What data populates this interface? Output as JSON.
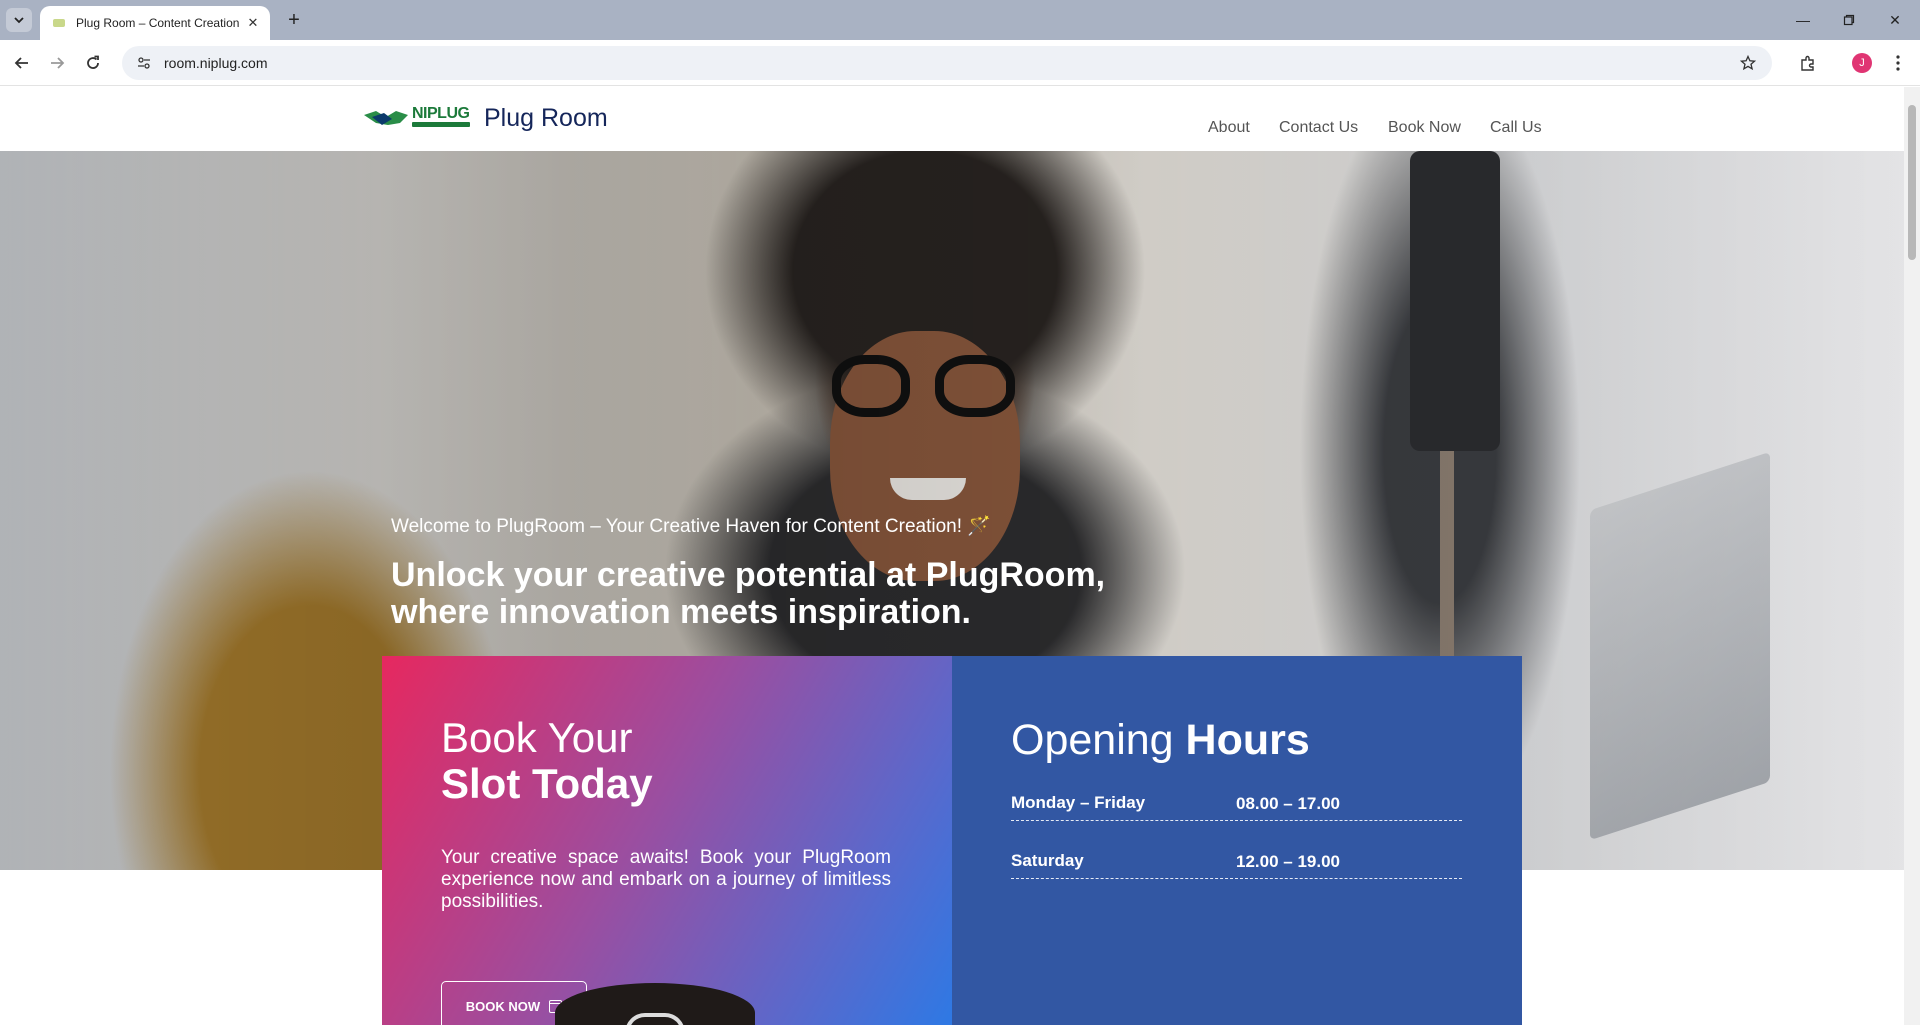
{
  "browser": {
    "tab_title": "Plug Room – Content Creation",
    "url": "room.niplug.com",
    "profile_initial": "J"
  },
  "site": {
    "logo_text": "NIPLUG",
    "title": "Plug Room",
    "nav": [
      "About",
      "Contact Us",
      "Book Now",
      "Call Us"
    ]
  },
  "hero": {
    "greeting": "Welcome to PlugRoom – Your Creative Haven for Content Creation! 🪄",
    "headline": "Unlock your creative potential at PlugRoom, where innovation meets inspiration."
  },
  "booking": {
    "title_light": "Book Your",
    "title_bold": "Slot Today",
    "text": "Your creative space awaits! Book your PlugRoom experience now and embark on a journey of limitless possibilities.",
    "button_label": "BOOK NOW"
  },
  "hours": {
    "title_light": "Opening",
    "title_bold": "Hours",
    "rows": [
      {
        "day": "Monday – Friday",
        "time": "08.00 – 17.00"
      },
      {
        "day": "Saturday",
        "time": "12.00 – 19.00"
      }
    ]
  },
  "colors": {
    "booking_gradient_start": "#e6285f",
    "booking_gradient_end": "#2b7ae6",
    "hours_bg": "#3257a3",
    "site_title": "#15265a"
  }
}
